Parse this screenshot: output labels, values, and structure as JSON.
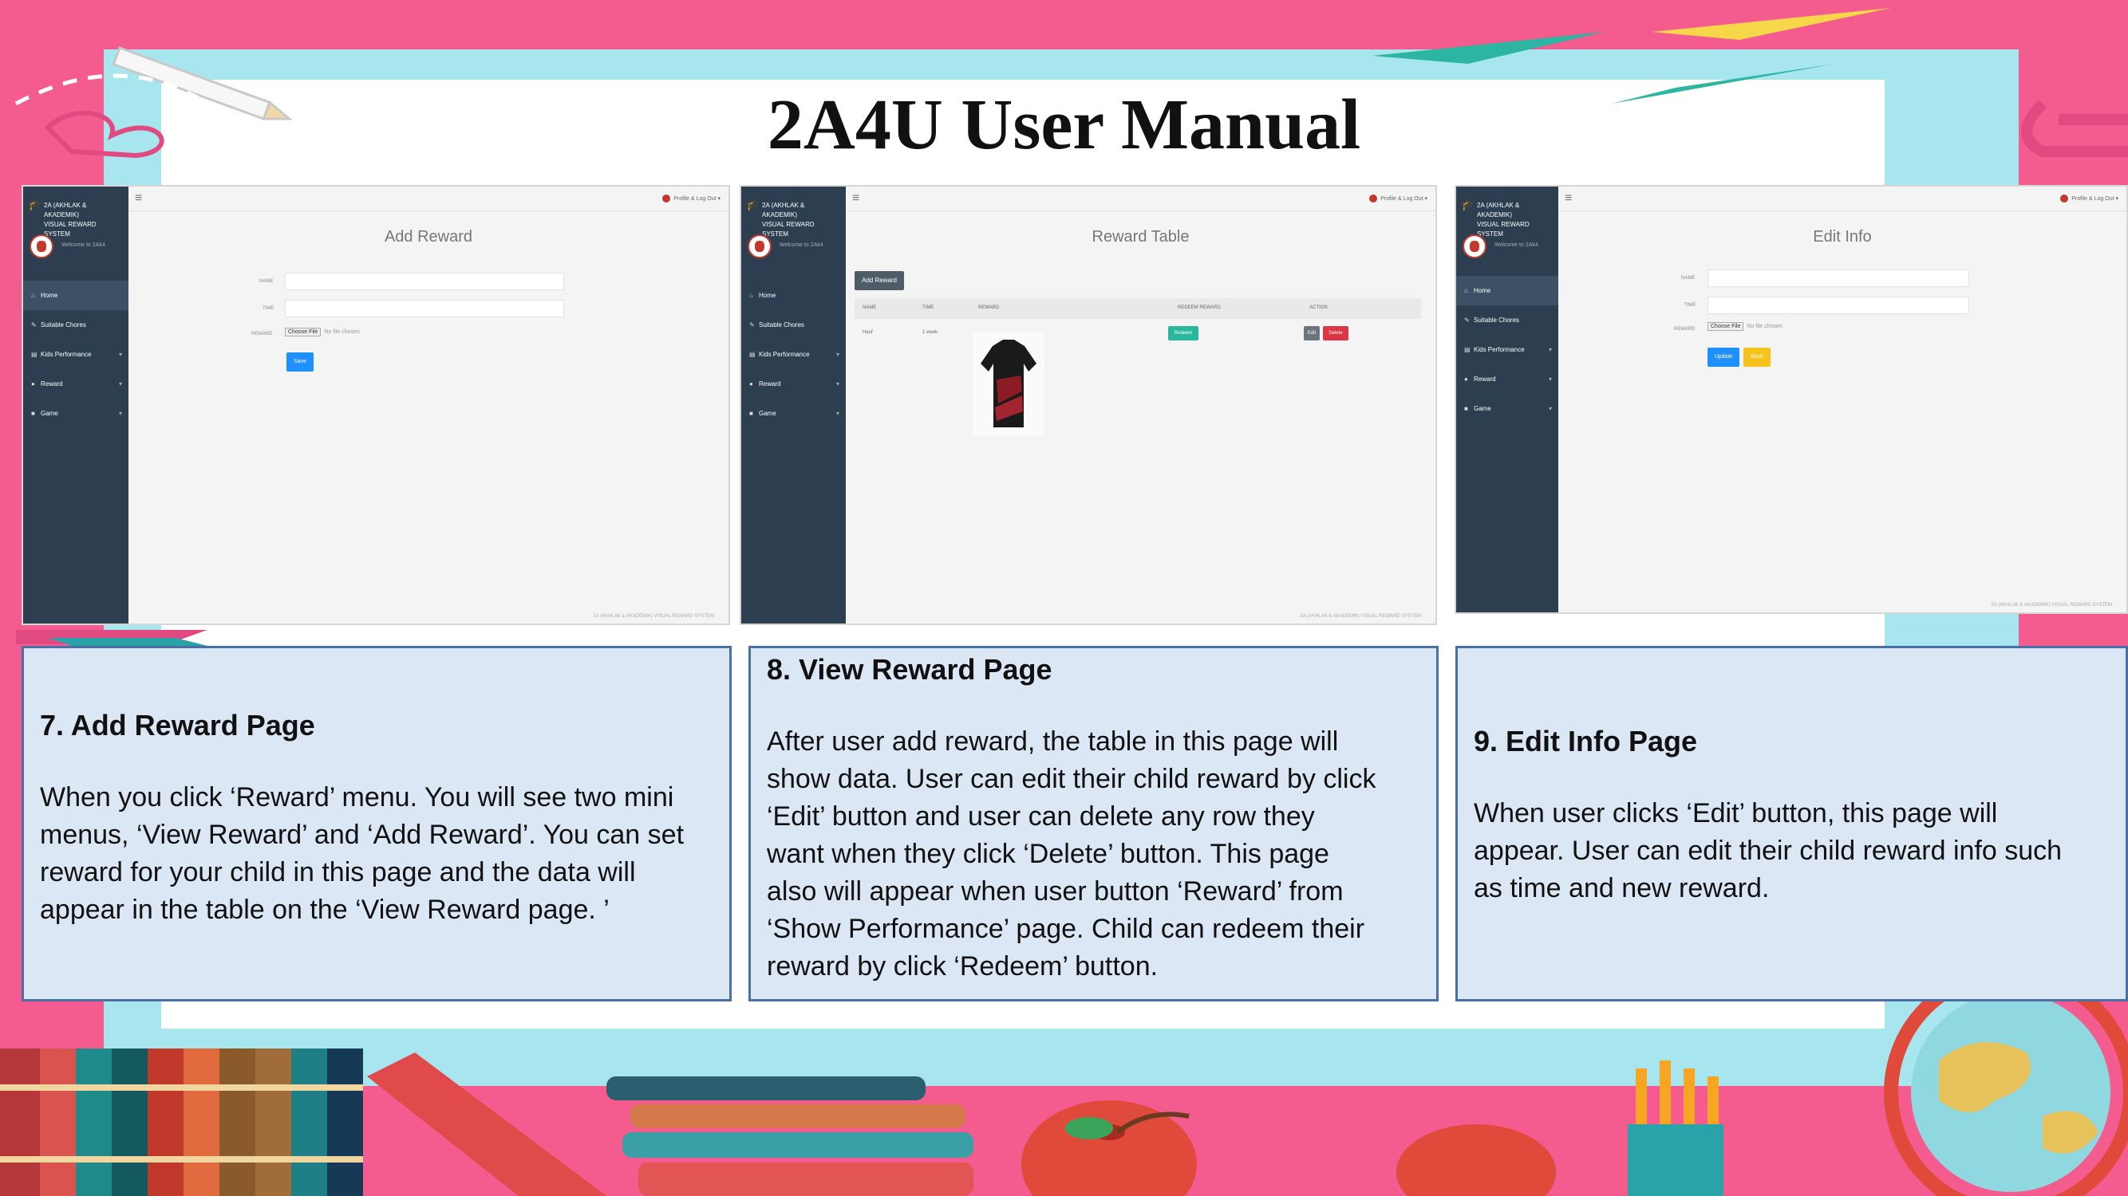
{
  "title": "2A4U User Manual",
  "colors": {
    "background": "#f45b8f",
    "frame": "#a8e6ef",
    "card_bg": "#dce7f5",
    "card_border": "#4a6fa5",
    "sidebar": "#2c3e50"
  },
  "screenshots": {
    "app": {
      "brand_line1": "2A (AKHLAK & AKADEMIK)",
      "brand_line2": "VISUAL REWARD SYSTEM",
      "welcome": "Welcome to 2Ak4",
      "profile": "Profile & Log Out",
      "menu": [
        "Home",
        "Suitable Chores",
        "Kids Performance",
        "Reward",
        "Game"
      ],
      "footer": "2A (AKHLAK & AKADEMIK) VISUAL REWARD SYSTEM"
    },
    "add_reward": {
      "heading": "Add Reward",
      "labels": [
        "NAME",
        "TIME",
        "REWARD"
      ],
      "file_button": "Choose File",
      "file_text": "No file chosen",
      "save": "Save"
    },
    "reward_table": {
      "heading": "Reward Table",
      "add_button": "Add Reward",
      "columns": [
        "NAME",
        "TIME",
        "REWARD",
        "REDEEM REWARD",
        "ACTION"
      ],
      "row": {
        "name": "Hauf",
        "time": "1 week",
        "redeem": "Redeem",
        "edit": "Edit",
        "delete": "Delete"
      }
    },
    "edit_info": {
      "heading": "Edit Info",
      "labels": [
        "NAME",
        "TIME",
        "REWARD"
      ],
      "file_button": "Choose File",
      "file_text": "No file chosen",
      "update": "Update",
      "back": "Back"
    }
  },
  "cards": [
    {
      "heading": "7. Add Reward Page",
      "lines": [
        "When you click ‘Reward’ menu. You will see two mini",
        "menus, ‘View Reward’ and ‘Add Reward’. You can set",
        "reward for your child in this page and the data will",
        "appear in the table on the ‘View Reward page. ’"
      ]
    },
    {
      "heading": "8. View Reward Page",
      "lines": [
        "After user add reward, the table in this page will",
        "show data. User can edit their child reward by click",
        "‘Edit’ button and user can delete any row they",
        "want when they click ‘Delete’ button. This page",
        "also will appear when user button ‘Reward’ from",
        "‘Show Performance’ page. Child can redeem their",
        "reward by click ‘Redeem’ button."
      ]
    },
    {
      "heading": "9. Edit  Info Page",
      "lines": [
        "When user clicks ‘Edit’ button, this page will",
        "appear. User can edit their child reward info such",
        "as time and new reward."
      ]
    }
  ]
}
